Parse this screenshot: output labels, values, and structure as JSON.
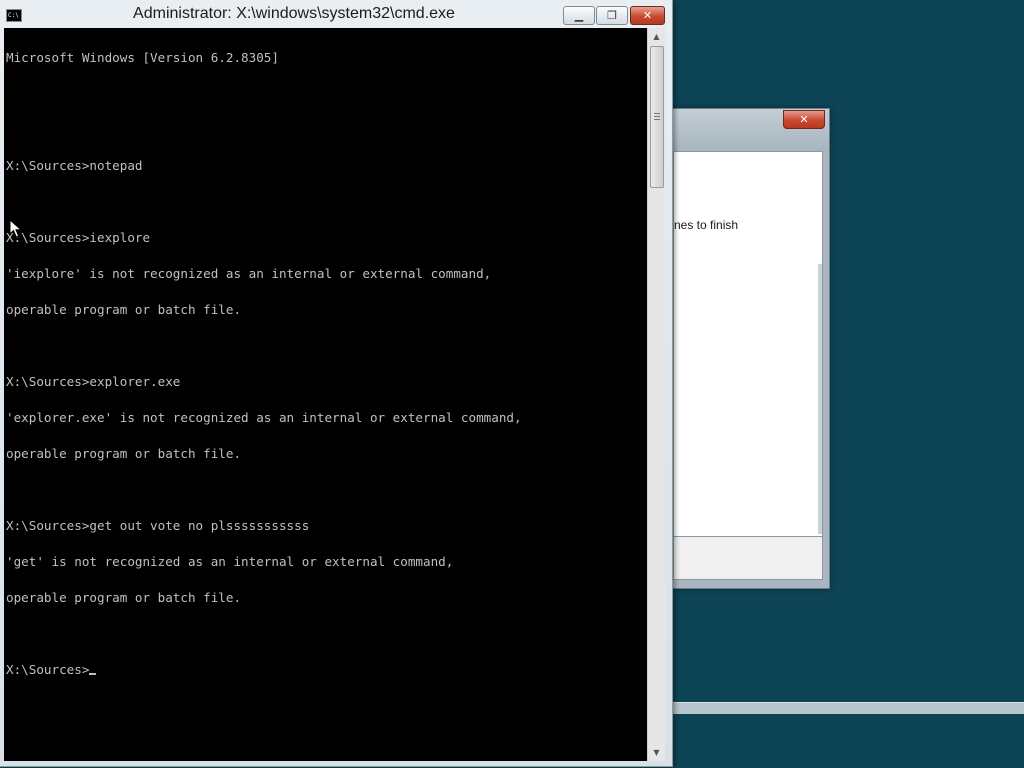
{
  "cmd_window": {
    "title": "Administrator: X:\\windows\\system32\\cmd.exe",
    "icon_label": "C:\\",
    "buttons": {
      "minimize": "minimize-icon",
      "maximize": "restore-icon",
      "close": "close-icon"
    },
    "console_lines": [
      "Microsoft Windows [Version 6.2.8305]",
      "",
      "",
      "X:\\Sources>notepad",
      "",
      "X:\\Sources>iexplore",
      "'iexplore' is not recognized as an internal or external command,",
      "operable program or batch file.",
      "",
      "X:\\Sources>explorer.exe",
      "'explorer.exe' is not recognized as an internal or external command,",
      "operable program or batch file.",
      "",
      "X:\\Sources>get out vote no plsssssssssss",
      "'get' is not recognized as an internal or external command,",
      "operable program or batch file.",
      ""
    ],
    "prompt": "X:\\Sources>",
    "colors": {
      "console_bg": "#000000",
      "console_text": "#c0c0c0"
    }
  },
  "background_dialog": {
    "status_text": "nes to finish",
    "close_icon": "close-icon"
  },
  "desktop": {
    "background_color": "#0c4456"
  }
}
